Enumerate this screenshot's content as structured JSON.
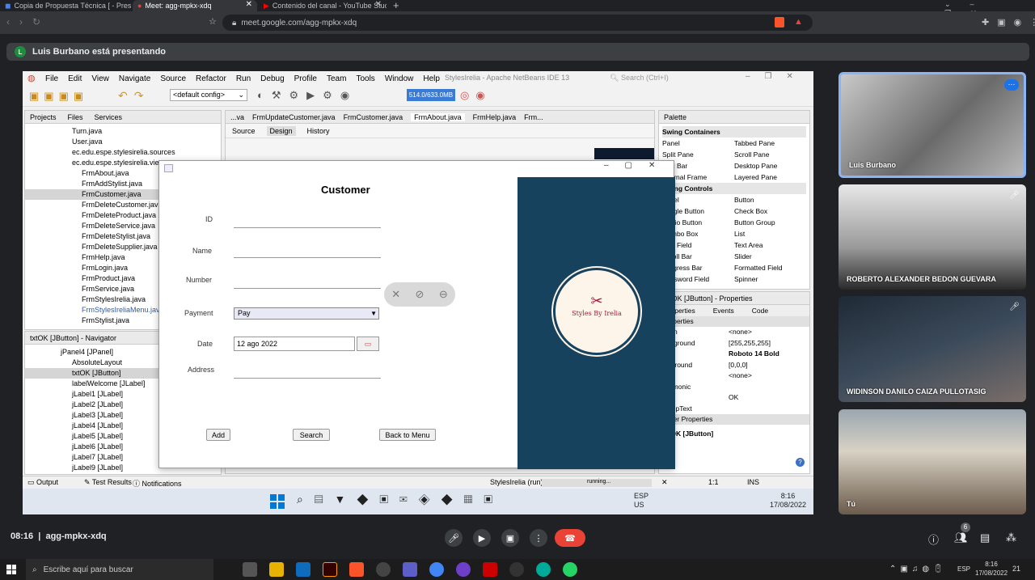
{
  "browser": {
    "tabs": [
      {
        "label": "Copia de Propuesta Técnica [ - Present"
      },
      {
        "label": "Meet: agg-mpkx-xdq"
      },
      {
        "label": "Contenido del canal - YouTube Studio"
      }
    ],
    "url": "meet.google.com/agg-mpkx-xdq"
  },
  "meet": {
    "presenter_initial": "L",
    "presenter_banner": "Luis Burbano está presentando",
    "time": "08:16",
    "meeting_code": "agg-mpkx-xdq",
    "participant_count": "6",
    "participants": [
      {
        "name": "Luis Burbano"
      },
      {
        "name": "ROBERTO ALEXANDER BEDON GUEVARA"
      },
      {
        "name": "WIDINSON DANILO CAIZA PULLOTASIG"
      },
      {
        "name": "Tú"
      }
    ]
  },
  "netbeans": {
    "title": "StylesIrelia - Apache NetBeans IDE 13",
    "menu": [
      "File",
      "Edit",
      "View",
      "Navigate",
      "Source",
      "Refactor",
      "Run",
      "Debug",
      "Profile",
      "Team",
      "Tools",
      "Window",
      "Help"
    ],
    "search_placeholder": "Search (Ctrl+I)",
    "config": "<default config>",
    "memory": "514.0/633.0MB",
    "panel_tabs": [
      "Projects",
      "Files",
      "Services"
    ],
    "project_tree": [
      "Turn.java",
      "User.java",
      "ec.edu.espe.stylesirelia.sources",
      "ec.edu.espe.stylesirelia.view",
      "FrmAbout.java",
      "FrmAddStylist.java",
      "FrmCustomer.java",
      "FrmDeleteCustomer.java",
      "FrmDeleteProduct.java",
      "FrmDeleteService.java",
      "FrmDeleteStylist.java",
      "FrmDeleteSupplier.java",
      "FrmHelp.java",
      "FrmLogin.java",
      "FrmProduct.java",
      "FrmService.java",
      "FrmStylesIrelia.java",
      "FrmStylesIreliaMenu.java",
      "FrmStylist.java"
    ],
    "navigator_title": "txtOK [JButton] - Navigator",
    "navigator_tree": [
      "jPanel4 [JPanel]",
      "AbsoluteLayout",
      "txtOK [JButton]",
      "labelWelcome [JLabel]",
      "jLabel1 [JLabel]",
      "jLabel2 [JLabel]",
      "jLabel3 [JLabel]",
      "jLabel4 [JLabel]",
      "jLabel5 [JLabel]",
      "jLabel6 [JLabel]",
      "jLabel7 [JLabel]",
      "jLabel9 [JLabel]"
    ],
    "editor_tabs": [
      "...va",
      "FrmUpdateCustomer.java",
      "FrmCustomer.java",
      "FrmAbout.java",
      "FrmHelp.java",
      "Frm..."
    ],
    "editor_subtabs": [
      "Source",
      "Design",
      "History"
    ],
    "palette_title": "Palette",
    "palette_sections": [
      "Swing Containers",
      "Swing Controls"
    ],
    "palette_containers": [
      "Panel",
      "Tabbed Pane",
      "Split Pane",
      "Scroll Pane",
      "Tool Bar",
      "Desktop Pane",
      "Internal Frame",
      "Layered Pane"
    ],
    "palette_controls": [
      "Label",
      "Button",
      "Toggle Button",
      "Check Box",
      "Radio Button",
      "Button Group",
      "Combo Box",
      "List",
      "Text Field",
      "Text Area",
      "Scroll Bar",
      "Slider",
      "Progress Bar",
      "Formatted Field",
      "Password Field",
      "Spinner"
    ],
    "props_title": "txtOK [JButton] - Properties",
    "props_tabs": [
      "Properties",
      "Events",
      "Code"
    ],
    "props_header": "Properties",
    "props_rows": [
      {
        "k": "action",
        "v": "<none>"
      },
      {
        "k": "background",
        "v": "[255,255,255]"
      },
      {
        "k": "font",
        "v": "Roboto 14 Bold"
      },
      {
        "k": "foreground",
        "v": "[0,0,0]"
      },
      {
        "k": "icon",
        "v": "<none>"
      },
      {
        "k": "mnemonic",
        "v": ""
      },
      {
        "k": "text",
        "v": "OK"
      },
      {
        "k": "toolTipText",
        "v": ""
      }
    ],
    "props_other": "Other Properties",
    "props_footer": "txtOK [JButton]",
    "status": {
      "output": "Output",
      "tests": "Test Results",
      "notifications": "Notifications",
      "run": "StylesIrelia (run)",
      "running": "running...",
      "pos": "1:1",
      "mode": "INS"
    }
  },
  "form": {
    "title": "Customer",
    "labels": {
      "id": "ID",
      "name": "Name",
      "number": "Number",
      "payment": "Payment",
      "date": "Date",
      "address": "Address"
    },
    "payment_value": "Pay",
    "date_value": "12 ago 2022",
    "buttons": {
      "add": "Add",
      "search": "Search",
      "back": "Back to Menu"
    },
    "brand": "Styles By Irelia"
  },
  "windows": {
    "search_placeholder": "Escribe aquí para buscar",
    "lang": "ESP",
    "region": "US",
    "clock_time": "8:16",
    "clock_date": "17/08/2022",
    "tray_lang": "ESP",
    "notif_count": "21"
  },
  "colors": {
    "accent": "#1a73e8",
    "brand_blue": "#17425e",
    "end_call": "#ea4335"
  }
}
